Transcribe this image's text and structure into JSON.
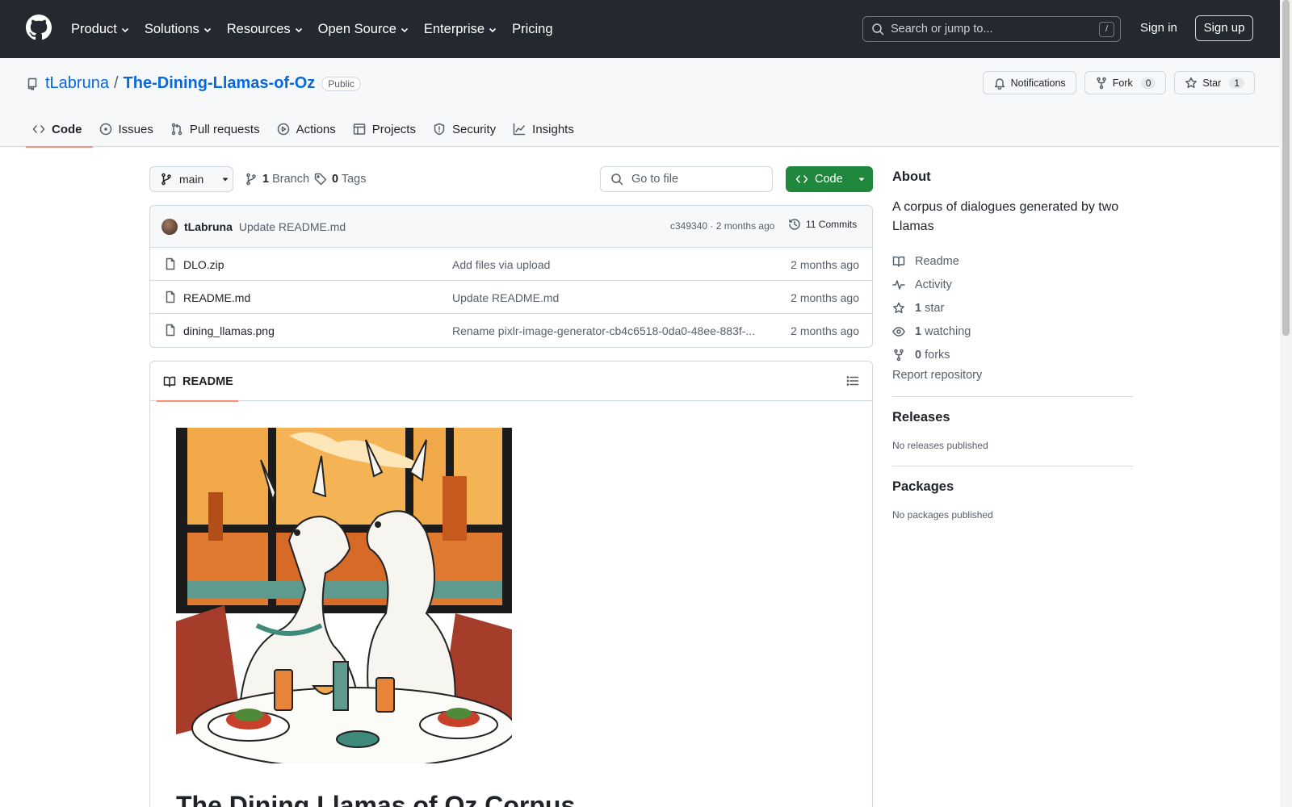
{
  "header": {
    "nav": [
      "Product",
      "Solutions",
      "Resources",
      "Open Source",
      "Enterprise",
      "Pricing"
    ],
    "search_placeholder": "Search or jump to...",
    "search_shortcut": "/",
    "sign_in": "Sign in",
    "sign_up": "Sign up"
  },
  "repo": {
    "owner": "tLabruna",
    "separator": "/",
    "name": "The-Dining-Llamas-of-Oz",
    "visibility": "Public",
    "actions": {
      "notifications": "Notifications",
      "fork": "Fork",
      "fork_count": "0",
      "star": "Star",
      "star_count": "1"
    },
    "tabs": [
      "Code",
      "Issues",
      "Pull requests",
      "Actions",
      "Projects",
      "Security",
      "Insights"
    ]
  },
  "toolbar": {
    "branch": "main",
    "branch_count": "1",
    "branch_label": "Branch",
    "tag_count": "0",
    "tag_label": "Tags",
    "goto_placeholder": "Go to file",
    "code_button": "Code"
  },
  "commit": {
    "author": "tLabruna",
    "message": "Update README.md",
    "meta": "c349340 · 2 months ago",
    "commits": "11 Commits"
  },
  "files": [
    {
      "name": "DLO.zip",
      "message": "Add files via upload",
      "date": "2 months ago"
    },
    {
      "name": "README.md",
      "message": "Update README.md",
      "date": "2 months ago"
    },
    {
      "name": "dining_llamas.png",
      "message": "Rename pixlr-image-generator-cb4c6518-0da0-48ee-883f-...",
      "date": "2 months ago"
    }
  ],
  "readme": {
    "tab": "README",
    "heading": "The Dining Llamas of Oz Corpus"
  },
  "about": {
    "title": "About",
    "description": "A corpus of dialogues generated by two Llamas",
    "readme": "Readme",
    "activity": "Activity",
    "stars_count": "1",
    "stars_label": "star",
    "watching_count": "1",
    "watching_label": "watching",
    "forks_count": "0",
    "forks_label": "forks",
    "report": "Report repository"
  },
  "releases": {
    "title": "Releases",
    "empty": "No releases published"
  },
  "packages": {
    "title": "Packages",
    "empty": "No packages published"
  },
  "colors": {
    "header_bg": "#24292f",
    "accent": "#0969da",
    "code_button": "#1f883d",
    "tab_underline": "#fd8c73"
  }
}
